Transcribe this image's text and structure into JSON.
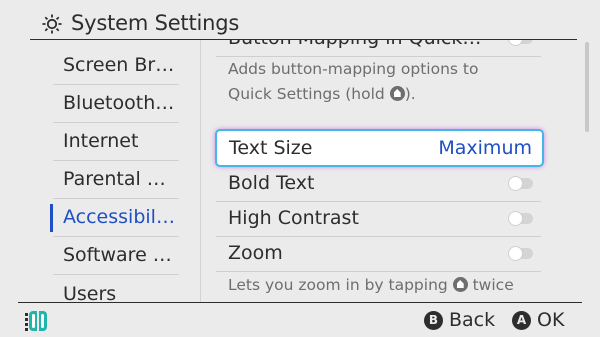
{
  "header": {
    "title": "System Settings",
    "icon": "gear-icon"
  },
  "sidebar": {
    "items": [
      {
        "label": "Screen Brightness",
        "active": false
      },
      {
        "label": "Bluetooth Audio",
        "active": false
      },
      {
        "label": "Internet",
        "active": false
      },
      {
        "label": "Parental Controls",
        "active": false
      },
      {
        "label": "Accessibility",
        "active": true
      },
      {
        "label": "Software Updates",
        "active": false
      },
      {
        "label": "Users",
        "active": false
      }
    ]
  },
  "content": {
    "partial_top_label": "Button Mapping in Quick…",
    "mapping_desc_line1": "Adds button-mapping options to",
    "mapping_desc_line2_pre": "Quick Settings (hold",
    "mapping_desc_line2_post": ").",
    "text_size": {
      "label": "Text Size",
      "value": "Maximum"
    },
    "bold_text": {
      "label": "Bold Text",
      "on": false
    },
    "high_contrast": {
      "label": "High Contrast",
      "on": false
    },
    "zoom": {
      "label": "Zoom",
      "on": false
    },
    "zoom_desc_pre": "Lets you zoom in by tapping",
    "zoom_desc_post": "twice"
  },
  "footer": {
    "back": {
      "button": "B",
      "label": "Back"
    },
    "ok": {
      "button": "A",
      "label": "OK"
    }
  },
  "colors": {
    "accent": "#1f4fc4",
    "background": "#ebebeb",
    "selection_border": "#45b6e8"
  }
}
